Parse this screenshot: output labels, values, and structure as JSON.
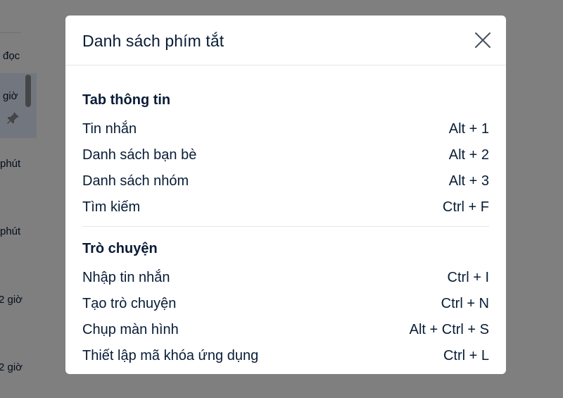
{
  "background": {
    "left_items": [
      "đọc",
      "giờ",
      "phút",
      "phút",
      "2 giờ",
      "2 giờ"
    ],
    "pin_icon": "pin-icon"
  },
  "dialog": {
    "title": "Danh sách phím tắt",
    "close_icon": "close-icon",
    "sections": [
      {
        "title": "Tab thông tin",
        "items": [
          {
            "label": "Tin nhắn",
            "keys": "Alt + 1"
          },
          {
            "label": "Danh sách bạn bè",
            "keys": "Alt + 2"
          },
          {
            "label": "Danh sách nhóm",
            "keys": "Alt + 3"
          },
          {
            "label": "Tìm kiếm",
            "keys": "Ctrl + F"
          }
        ]
      },
      {
        "title": "Trò chuyện",
        "items": [
          {
            "label": "Nhập tin nhắn",
            "keys": "Ctrl + I"
          },
          {
            "label": "Tạo trò chuyện",
            "keys": "Ctrl + N"
          },
          {
            "label": "Chụp màn hình",
            "keys": "Alt + Ctrl + S"
          },
          {
            "label": "Thiết lập mã khóa ứng dụng",
            "keys": "Ctrl + L"
          }
        ]
      }
    ]
  },
  "colors": {
    "overlay": "#000000",
    "text": "#081c36",
    "divider": "#e4e6eb"
  }
}
